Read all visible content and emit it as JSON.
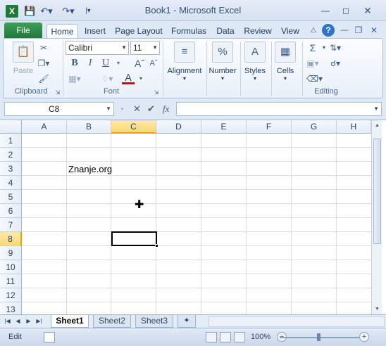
{
  "window": {
    "title": "Book1 - Microsoft Excel"
  },
  "ribbon_tabs": [
    "File",
    "Home",
    "Insert",
    "Page Layout",
    "Formulas",
    "Data",
    "Review",
    "View"
  ],
  "active_tab": "Home",
  "ribbon": {
    "clipboard": {
      "paste_label": "Paste",
      "group_label": "Clipboard"
    },
    "font": {
      "font_name": "Calibri",
      "font_size": "11",
      "group_label": "Font",
      "bold": "B",
      "italic": "I",
      "underline": "U",
      "font_color_glyph": "A"
    },
    "alignment_label": "Alignment",
    "number_label": "Number",
    "number_icon": "%",
    "styles_label": "Styles",
    "cells_label": "Cells",
    "editing_label": "Editing",
    "sum_glyph": "Σ"
  },
  "formula_bar": {
    "name_box": "C8",
    "fx": "fx",
    "formula": ""
  },
  "grid": {
    "columns": [
      "A",
      "B",
      "C",
      "D",
      "E",
      "F",
      "G",
      "H"
    ],
    "rows": [
      "1",
      "2",
      "3",
      "4",
      "5",
      "6",
      "7",
      "8",
      "9",
      "10",
      "11",
      "12",
      "13"
    ],
    "selected_column": "C",
    "selected_row": "8",
    "cells": {
      "B3": "Znanje.org"
    }
  },
  "sheets": [
    "Sheet1",
    "Sheet2",
    "Sheet3"
  ],
  "active_sheet": "Sheet1",
  "status": {
    "mode": "Edit",
    "zoom": "100%"
  },
  "colors": {
    "accent": "#217a3b",
    "selection": "#f9d877"
  }
}
